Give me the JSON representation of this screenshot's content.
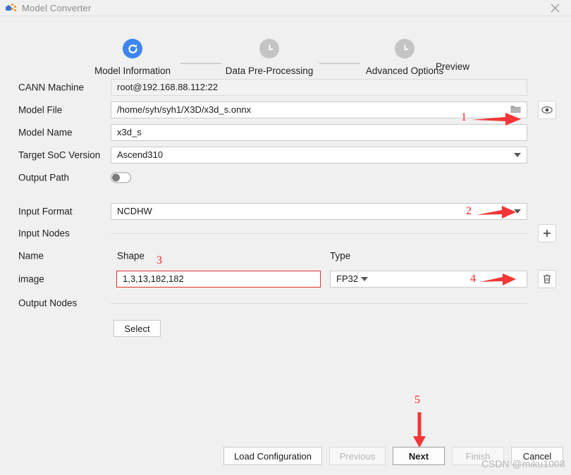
{
  "window": {
    "title": "Model Converter",
    "app_icon": "model-converter-icon",
    "close_icon": "close-icon"
  },
  "stepper": {
    "steps": [
      {
        "label": "Model Information",
        "state": "active",
        "icon": "refresh-circle-icon"
      },
      {
        "label": "Data Pre-Processing",
        "state": "pending",
        "icon": "clock-icon"
      },
      {
        "label": "Advanced Options",
        "state": "pending",
        "icon": "clock-icon"
      },
      {
        "label": "Preview",
        "state": "pending",
        "icon": "clock-icon"
      }
    ]
  },
  "form": {
    "cann_machine": {
      "label": "CANN Machine",
      "value": "root@192.168.88.112:22",
      "readonly": true
    },
    "model_file": {
      "label": "Model File",
      "value": "/home/syh/syh1/X3D/x3d_s.onnx",
      "browse_icon": "folder-icon",
      "preview_icon": "eye-icon"
    },
    "model_name": {
      "label": "Model Name",
      "value": "x3d_s"
    },
    "target_soc_version": {
      "label": "Target SoC Version",
      "value": "Ascend310",
      "caret_icon": "chevron-down-icon"
    },
    "output_path": {
      "label": "Output Path",
      "toggle_state": "off"
    },
    "input_format": {
      "label": "Input Format",
      "value": "NCDHW",
      "caret_icon": "chevron-down-icon"
    },
    "input_nodes": {
      "label": "Input Nodes",
      "add_icon": "plus-icon",
      "columns": [
        "Name",
        "Shape",
        "Type"
      ],
      "rows": [
        {
          "name": "image",
          "shape": "1,3,13,182,182",
          "type": "FP32",
          "shape_highlighted": true,
          "delete_icon": "trash-icon",
          "caret_icon": "chevron-down-icon"
        }
      ]
    },
    "output_nodes": {
      "label": "Output Nodes",
      "select_label": "Select"
    }
  },
  "footer": {
    "buttons": [
      {
        "label": "Load Configuration",
        "state": "enabled"
      },
      {
        "label": "Previous",
        "state": "disabled"
      },
      {
        "label": "Next",
        "state": "primary"
      },
      {
        "label": "Finish",
        "state": "disabled"
      },
      {
        "label": "Cancel",
        "state": "enabled"
      }
    ]
  },
  "annotations": {
    "numbers": [
      "1",
      "2",
      "3",
      "4",
      "5"
    ],
    "color": "#ff2020",
    "watermark": "CSDN @miku1008"
  }
}
